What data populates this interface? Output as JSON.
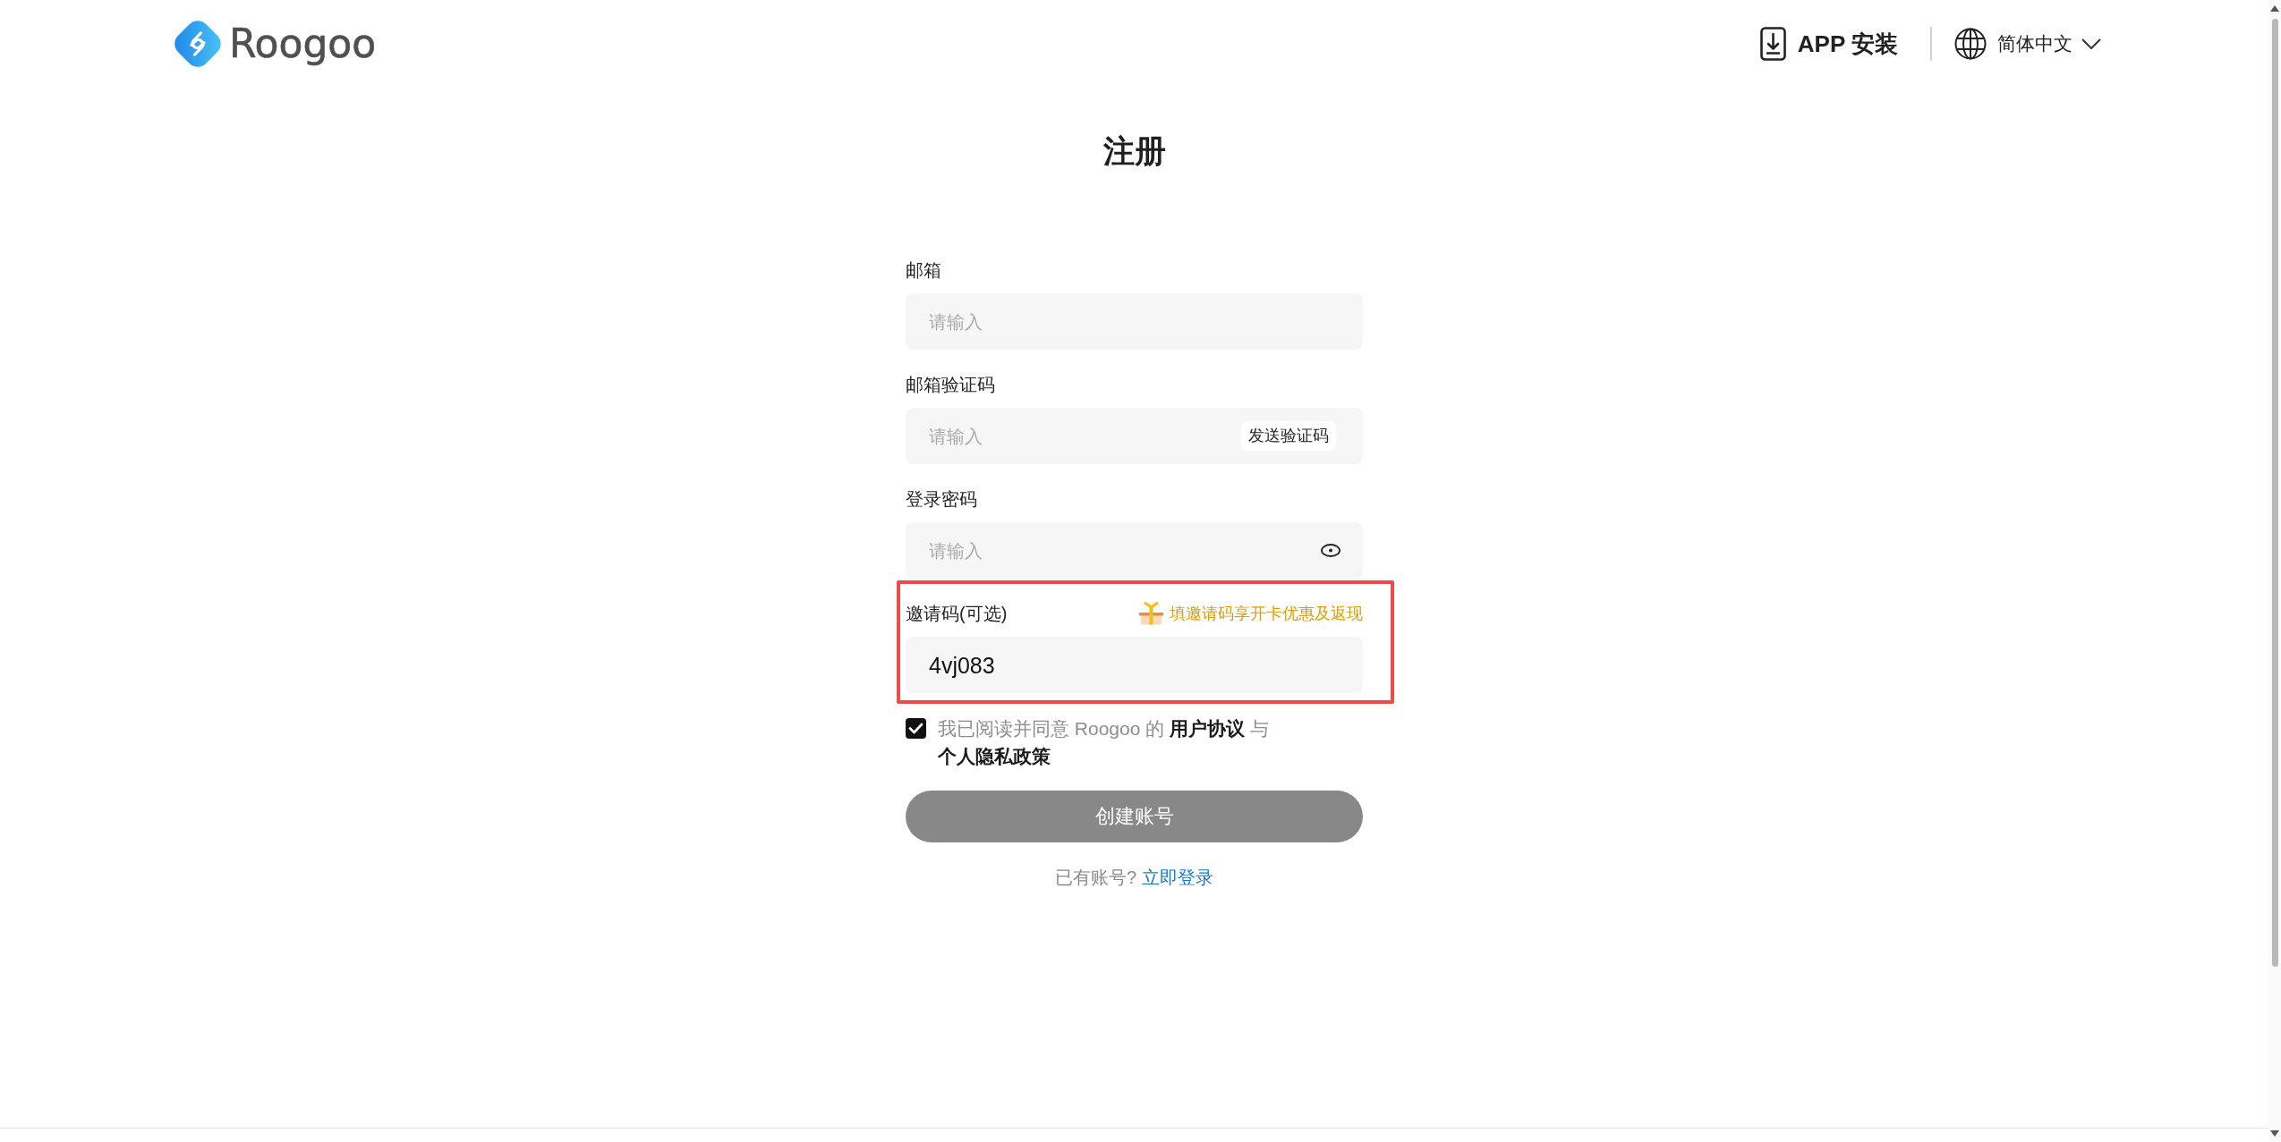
{
  "header": {
    "logo": {
      "text": "Roogoo"
    },
    "app_install": {
      "label": "APP 安装"
    },
    "language": {
      "label": "简体中文"
    }
  },
  "title": "注册",
  "fields": [
    {
      "kind": "text",
      "label": "邮箱",
      "placeholder": "请输入",
      "highlighted": false
    },
    {
      "kind": "code",
      "label": "邮箱验证码",
      "placeholder": "请输入",
      "action": "发送验证码",
      "highlighted": false
    },
    {
      "kind": "password",
      "label": "登录密码",
      "placeholder": "请输入",
      "highlighted": false
    },
    {
      "kind": "invite",
      "label": "邀请码(可选)",
      "hint": "填邀请码享开卡优惠及返现",
      "value": "4vj083",
      "highlighted": true
    }
  ],
  "agreement": {
    "checked": true,
    "parts": [
      {
        "kind": "text",
        "text": "我已阅读并同意 Roogoo 的"
      },
      {
        "kind": "link",
        "text": "用户协议"
      },
      {
        "kind": "text",
        "text": "与"
      },
      {
        "kind": "link",
        "text": "个人隐私政策"
      }
    ]
  },
  "submit": {
    "label": "创建账号",
    "disabled": true
  },
  "login_prompt": {
    "text": "已有账号?",
    "link": "立即登录"
  }
}
